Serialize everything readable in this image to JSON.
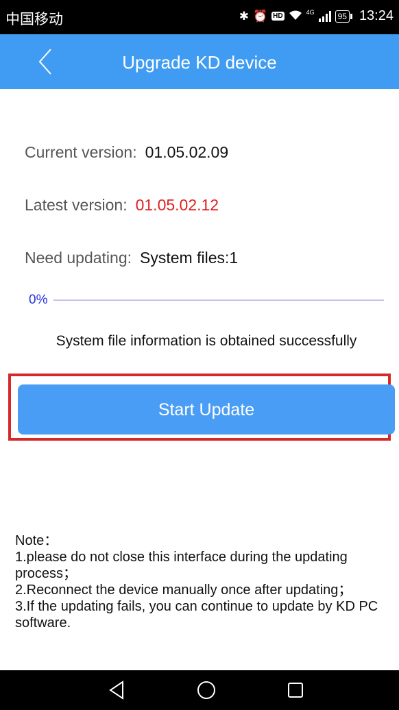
{
  "status_bar": {
    "carrier": "中国移动",
    "network": "4G",
    "battery": "95",
    "time": "13:24"
  },
  "header": {
    "title": "Upgrade KD device"
  },
  "current_version": {
    "label": "Current version:",
    "value": "01.05.02.09"
  },
  "latest_version": {
    "label": "Latest version:",
    "value": "01.05.02.12",
    "value_color": "#e02020"
  },
  "need_updating": {
    "label": "Need updating:",
    "value": "System files:1"
  },
  "progress": {
    "text": "0%",
    "value": 0
  },
  "info_message": "System file information is obtained successfully",
  "start_button": {
    "label": "Start Update",
    "color": "#4a9df5"
  },
  "note": {
    "title": "Note：",
    "lines": [
      "1.please do not close this interface during the updating process；",
      "2.Reconnect the device manually once after updating；",
      "3.If the updating fails, you can continue to update by KD PC software."
    ]
  },
  "colors": {
    "accent": "#3f9cf2",
    "highlight_frame": "#d62828"
  },
  "nav_bar": {
    "icons": [
      "back-triangle-icon",
      "home-circle-icon",
      "recents-square-icon"
    ]
  }
}
